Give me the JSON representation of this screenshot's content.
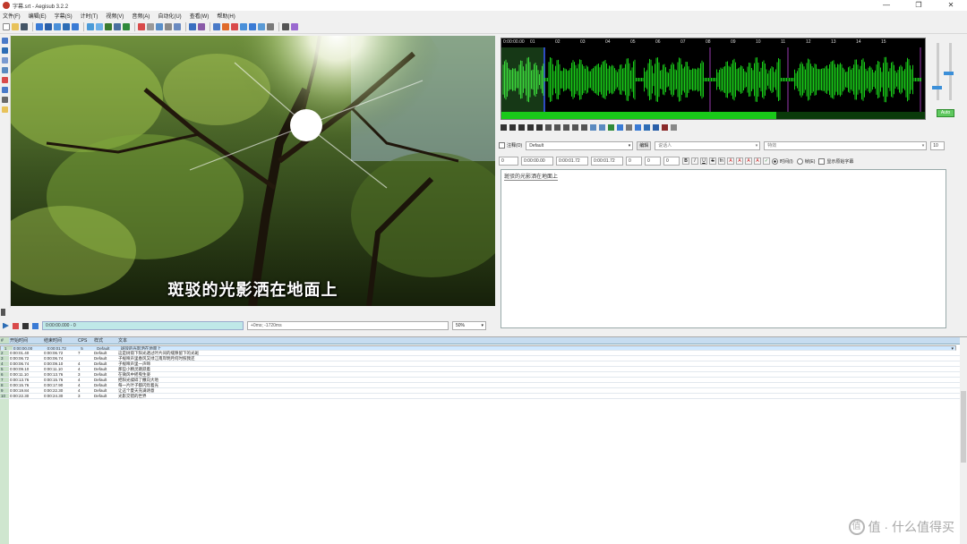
{
  "window": {
    "title": "字幕.srt - Aegisub 3.2.2",
    "controls": [
      "—",
      "❐",
      "✕"
    ]
  },
  "menu": [
    "文件(F)",
    "编辑(E)",
    "字幕(S)",
    "计时(T)",
    "视频(V)",
    "音频(A)",
    "自动化(U)",
    "查看(W)",
    "帮助(H)"
  ],
  "video": {
    "subtitle_overlay": "斑驳的光影洒在地面上",
    "current_time": "0:00:00.000 - 0",
    "duration_text": "+0ms; -1720ms",
    "zoom": "50%"
  },
  "audio": {
    "ruler_labels": [
      "0:00:00.00",
      "01",
      "02",
      "03",
      "04",
      "05",
      "06",
      "07",
      "08",
      "09",
      "10",
      "11",
      "12",
      "13",
      "14",
      "15"
    ],
    "progress": 0.65,
    "auto_label": "Auto",
    "colors": {
      "background": "#000000",
      "waveform": "#19c919",
      "selection": "#1a3a1a",
      "progress": "#19c919"
    }
  },
  "edit": {
    "comment_label": "注释(O)",
    "style": "Default",
    "edit_button": "编辑",
    "actor_placeholder": "说话人",
    "effect_placeholder": "特效",
    "char_count": "10",
    "layer": "0",
    "start": "0:00:00.00",
    "end": "0:00:01.72",
    "duration": "0:00:01.72",
    "margin_l": "0",
    "margin_r": "0",
    "margin_v": "0",
    "format_buttons": [
      "B",
      "I",
      "U",
      "S",
      "fn",
      "A",
      "A",
      "A",
      "A"
    ],
    "time_mode_label": "时间(I)",
    "frame_mode_label": "帧(E)",
    "show_original_label": "显示原始字幕",
    "text": "斑驳的光影洒在地面上"
  },
  "grid": {
    "headers": [
      "#",
      "开始时间",
      "结束时间",
      "CPS",
      "样式",
      "文本"
    ],
    "rows": [
      {
        "n": "1",
        "start": "0:00:00.00",
        "end": "0:00:01.72",
        "cps": "5",
        "style": "Default",
        "text": "斑驳的光影洒在地面上"
      },
      {
        "n": "2",
        "start": "0:00:01.40",
        "end": "0:00:06.72",
        "cps": "7",
        "style": "Default",
        "text": "这是树荫下阳光透过叶片间的缝隙留下的光斑"
      },
      {
        "n": "3",
        "start": "0:00:06.72",
        "end": "0:00:06.74",
        "cps": "",
        "style": "Default",
        "text": "子规啼声里春风又绿江南岸明月何时照我还"
      },
      {
        "n": "4",
        "start": "0:00:06.74",
        "end": "0:00:09.10",
        "cps": "4",
        "style": "Default",
        "text": "子规啼声里一声啼"
      },
      {
        "n": "5",
        "start": "0:00:09.10",
        "end": "0:00:11.10",
        "cps": "4",
        "style": "Default",
        "text": "那些小精灵跳跃着"
      },
      {
        "n": "6",
        "start": "0:00:11.10",
        "end": "0:00:13.76",
        "cps": "3",
        "style": "Default",
        "text": "在微风中摇曳生姿"
      },
      {
        "n": "7",
        "start": "0:00:13.76",
        "end": "0:00:15.76",
        "cps": "4",
        "style": "Default",
        "text": "把阳光揉碎了撒向大地"
      },
      {
        "n": "8",
        "start": "0:00:15.76",
        "end": "0:00:17.90",
        "cps": "4",
        "style": "Default",
        "text": "每一片叶子都闪烁着光"
      },
      {
        "n": "9",
        "start": "0:00:19.84",
        "end": "0:00:22.30",
        "cps": "4",
        "style": "Default",
        "text": "让这个夏天充满诗意"
      },
      {
        "n": "10",
        "start": "0:00:22.30",
        "end": "0:00:24.30",
        "cps": "3",
        "style": "Default",
        "text": "光影交错的世界"
      }
    ]
  },
  "watermark": {
    "text": "值 · 什么值得买",
    "icon": "值"
  }
}
